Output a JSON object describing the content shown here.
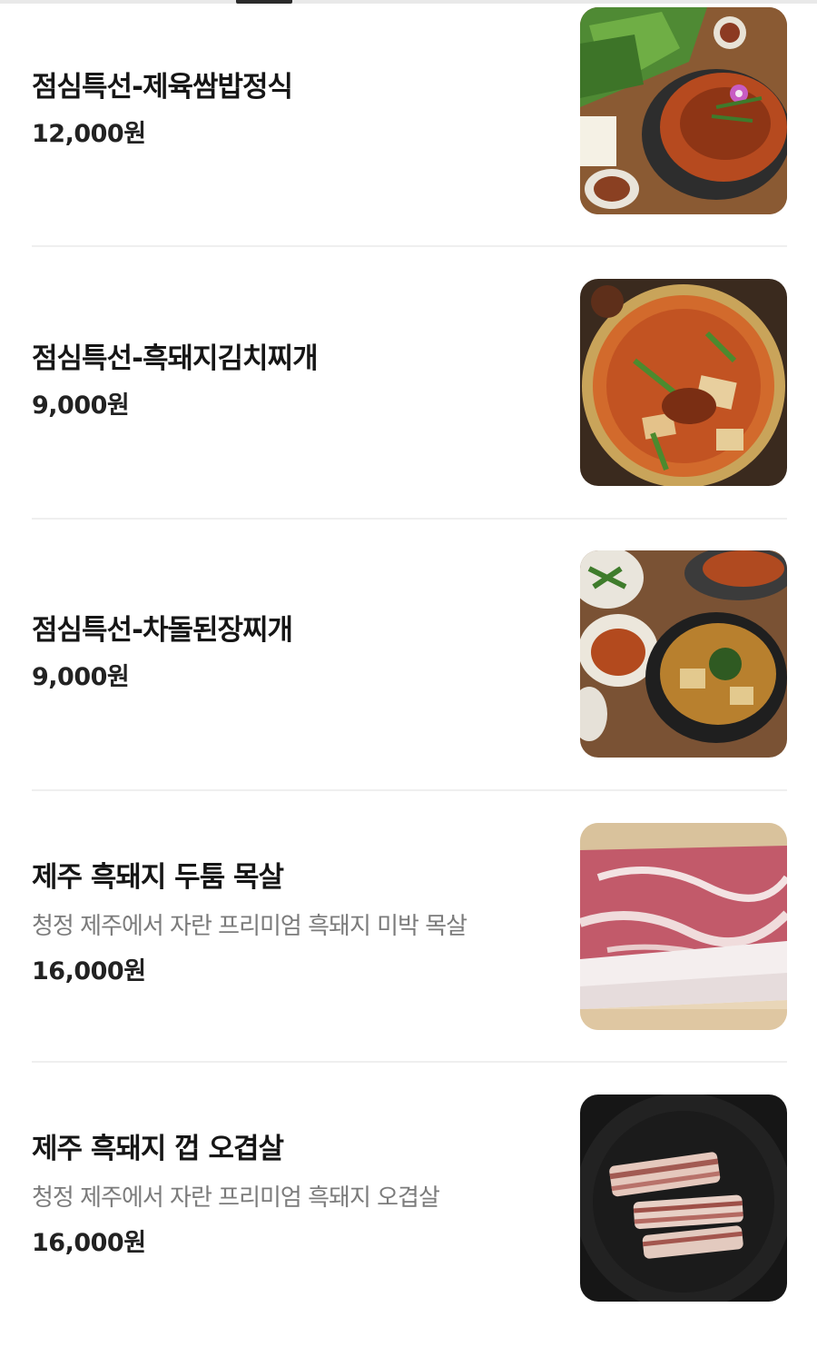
{
  "menu": {
    "items": [
      {
        "name": "점심특선-제육쌈밥정식",
        "description": "",
        "price": "12,000원",
        "image": "jeyuk-ssambap-photo"
      },
      {
        "name": "점심특선-흑돼지김치찌개",
        "description": "",
        "price": "9,000원",
        "image": "kimchi-jjigae-photo"
      },
      {
        "name": "점심특선-차돌된장찌개",
        "description": "",
        "price": "9,000원",
        "image": "doenjang-jjigae-photo"
      },
      {
        "name": "제주 흑돼지 두툼 목살",
        "description": "청정 제주에서 자란 프리미엄 흑돼지 미박 목살",
        "price": "16,000원",
        "image": "pork-neck-raw-photo"
      },
      {
        "name": "제주 흑돼지 껍 오겹살",
        "description": "청정 제주에서 자란 프리미엄 흑돼지 오겹살",
        "price": "16,000원",
        "image": "pork-belly-grill-photo"
      }
    ]
  },
  "colors": {
    "text_primary": "#161616",
    "text_secondary": "#7b7b7b",
    "divider": "#efefef",
    "tab_indicator": "#2b2b2b"
  }
}
